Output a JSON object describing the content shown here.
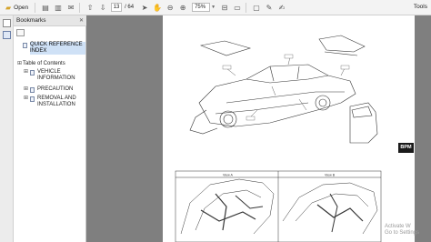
{
  "toolbar": {
    "open_label": "Open",
    "page_current": "13",
    "page_total": "/ 64",
    "zoom": "75%",
    "tools_label": "Tools"
  },
  "bookmarks": {
    "title": "Bookmarks",
    "items": [
      {
        "label": "QUICK REFERENCE INDEX",
        "selected": true
      },
      {
        "label": "Table of Contents"
      },
      {
        "label": "VEHICLE INFORMATION"
      },
      {
        "label": "PRECAUTION"
      },
      {
        "label": "REMOVAL AND INSTALLATION"
      }
    ]
  },
  "document": {
    "side_tab": "BPM",
    "view_a_label": "View A",
    "view_b_label": "View B"
  },
  "watermark": {
    "line1": "Activate W",
    "line2": "Go to Settings"
  }
}
